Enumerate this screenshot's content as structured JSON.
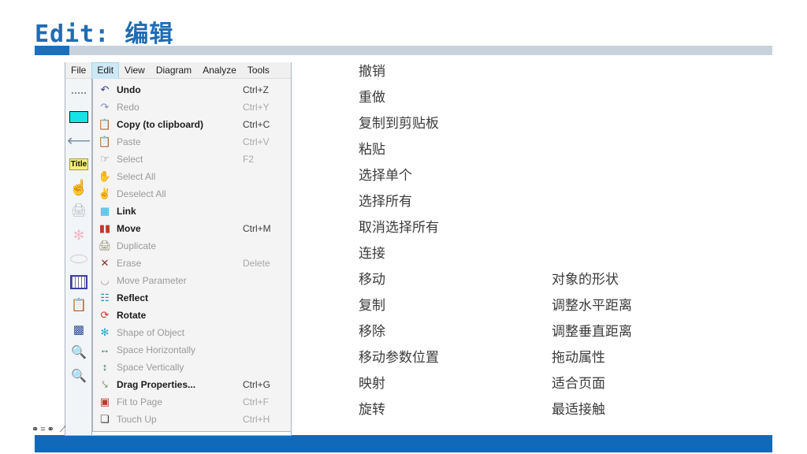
{
  "slide": {
    "title": "Edit: 编辑",
    "accent_color": "#1c6fba",
    "rule_color": "#c7d2dd",
    "footer_color": "#1169ba"
  },
  "app": {
    "menubar": [
      {
        "label": "File",
        "active": false
      },
      {
        "label": "Edit",
        "active": true
      },
      {
        "label": "View",
        "active": false
      },
      {
        "label": "Diagram",
        "active": false
      },
      {
        "label": "Analyze",
        "active": false
      },
      {
        "label": "Tools",
        "active": false
      }
    ],
    "toolbar_icons": [
      "dotted-handle-icon",
      "cyan-color-swatch-icon",
      "arrow-left-icon",
      "title-text-icon",
      "pointing-hand-icon",
      "duplicate-stamp-icon",
      "move-snowflake-icon",
      "ellipse-parameter-icon",
      "table-grid-icon",
      "clipboard-export-icon",
      "thermometer-chart-icon",
      "zoom-object-icon",
      "zoom-page-icon"
    ],
    "bottom_glyphs": "⚭=⚭   ⟋",
    "menu": [
      {
        "icon": "undo-icon",
        "label": "Undo",
        "shortcut": "Ctrl+Z",
        "enabled": true
      },
      {
        "icon": "redo-icon",
        "label": "Redo",
        "shortcut": "Ctrl+Y",
        "enabled": false
      },
      {
        "icon": "copy-clipboard-icon",
        "label": "Copy (to clipboard)",
        "shortcut": "Ctrl+C",
        "enabled": true
      },
      {
        "icon": "paste-icon",
        "label": "Paste",
        "shortcut": "Ctrl+V",
        "enabled": false
      },
      {
        "icon": "select-hand-icon",
        "label": "Select",
        "shortcut": "F2",
        "enabled": false
      },
      {
        "icon": "select-all-hand-icon",
        "label": "Select All",
        "shortcut": "",
        "enabled": false
      },
      {
        "icon": "deselect-all-hand-icon",
        "label": "Deselect All",
        "shortcut": "",
        "enabled": false
      },
      {
        "icon": "link-icon",
        "label": "Link",
        "shortcut": "",
        "enabled": true
      },
      {
        "icon": "move-icon",
        "label": "Move",
        "shortcut": "Ctrl+M",
        "enabled": true
      },
      {
        "icon": "duplicate-icon",
        "label": "Duplicate",
        "shortcut": "",
        "enabled": false
      },
      {
        "icon": "erase-icon",
        "label": "Erase",
        "shortcut": "Delete",
        "enabled": false
      },
      {
        "icon": "move-parameter-icon",
        "label": "Move Parameter",
        "shortcut": "",
        "enabled": false
      },
      {
        "icon": "reflect-icon",
        "label": "Reflect",
        "shortcut": "",
        "enabled": true
      },
      {
        "icon": "rotate-icon",
        "label": "Rotate",
        "shortcut": "",
        "enabled": true
      },
      {
        "icon": "shape-of-object-icon",
        "label": "Shape of Object",
        "shortcut": "",
        "enabled": false
      },
      {
        "icon": "space-horizontally-icon",
        "label": "Space Horizontally",
        "shortcut": "",
        "enabled": false
      },
      {
        "icon": "space-vertically-icon",
        "label": "Space Vertically",
        "shortcut": "",
        "enabled": false
      },
      {
        "icon": "drag-properties-icon",
        "label": "Drag Properties...",
        "shortcut": "Ctrl+G",
        "enabled": true
      },
      {
        "icon": "fit-to-page-icon",
        "label": "Fit to Page",
        "shortcut": "Ctrl+F",
        "enabled": false
      },
      {
        "icon": "touch-up-icon",
        "label": "Touch Up",
        "shortcut": "Ctrl+H",
        "enabled": false
      }
    ]
  },
  "translations": {
    "left_column": [
      "撤销",
      "重做",
      "复制到剪贴板",
      "粘贴",
      "选择单个",
      "选择所有",
      "取消选择所有",
      "连接",
      "移动",
      "复制",
      "移除",
      "移动参数位置",
      "映射",
      "旋转"
    ],
    "right_column": [
      "对象的形状",
      "调整水平距离",
      "调整垂直距离",
      "拖动属性",
      "适合页面",
      "最适接触"
    ]
  }
}
